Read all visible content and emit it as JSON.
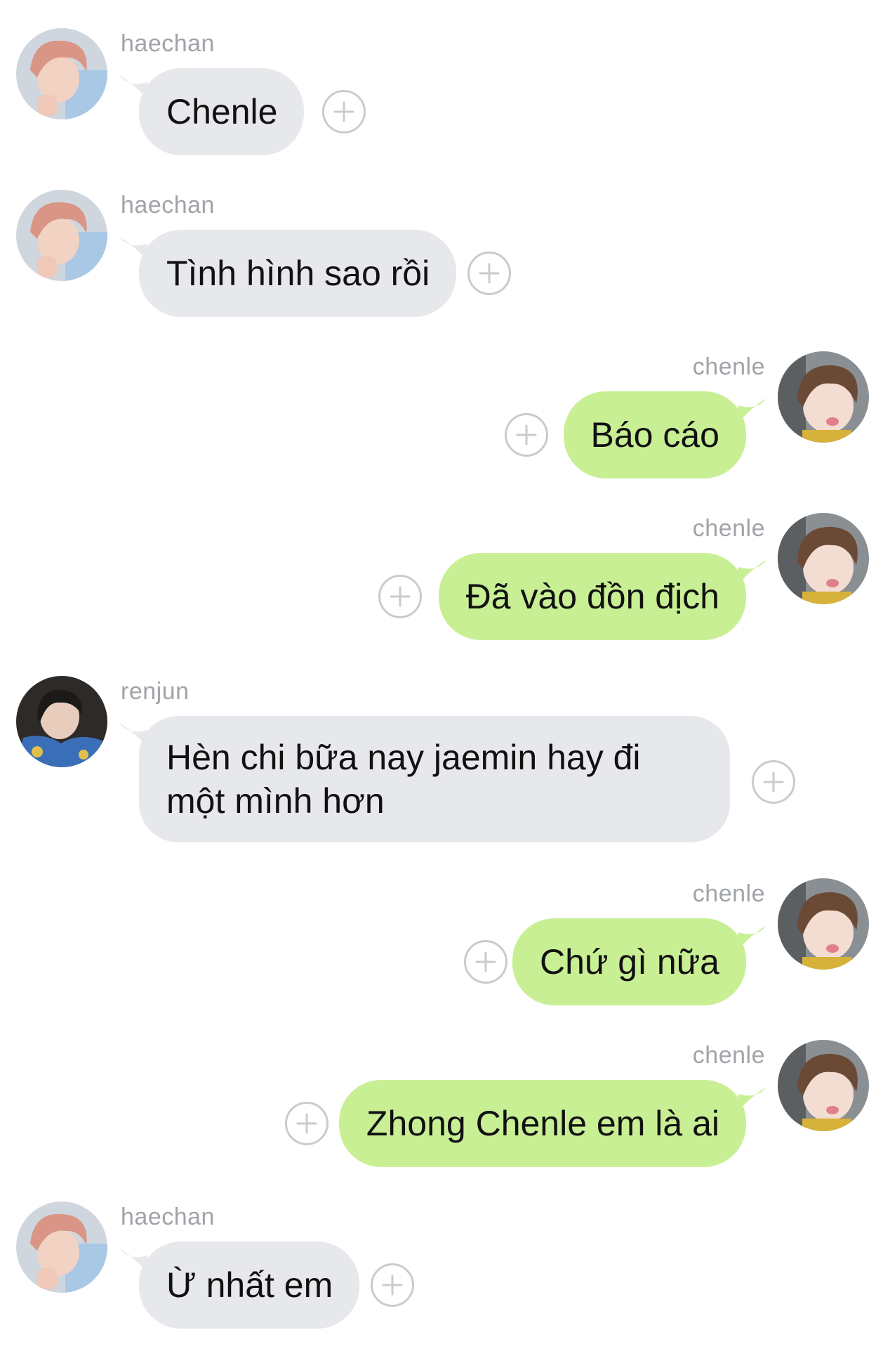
{
  "messages": [
    {
      "side": "left",
      "avatar": "haechan-avatar",
      "sender": "haechan",
      "text": "Chenle"
    },
    {
      "side": "left",
      "avatar": "haechan-avatar",
      "sender": "haechan",
      "text": "Tình hình sao rồi"
    },
    {
      "side": "right",
      "avatar": "chenle-avatar",
      "sender": "chenle",
      "text": "Báo cáo"
    },
    {
      "side": "right",
      "avatar": "chenle-avatar",
      "sender": "chenle",
      "text": "Đã vào đồn địch"
    },
    {
      "side": "left",
      "avatar": "renjun-avatar",
      "sender": "renjun",
      "text": "Hèn chi bữa nay jaemin hay đi một mình hơn"
    },
    {
      "side": "right",
      "avatar": "chenle-avatar",
      "sender": "chenle",
      "text": "Chứ gì nữa"
    },
    {
      "side": "right",
      "avatar": "chenle-avatar",
      "sender": "chenle",
      "text": "Zhong Chenle em là ai"
    },
    {
      "side": "left",
      "avatar": "haechan-avatar",
      "sender": "haechan",
      "text": "Ừ nhất em"
    }
  ],
  "colors": {
    "incoming_bubble": "#e6e8eb",
    "outgoing_bubble": "#c9ef95",
    "sender_name": "#a0a3a8",
    "add_reaction_icon": "#c9cbcf"
  },
  "icons": {
    "add_reaction": "plus-circle-icon"
  }
}
